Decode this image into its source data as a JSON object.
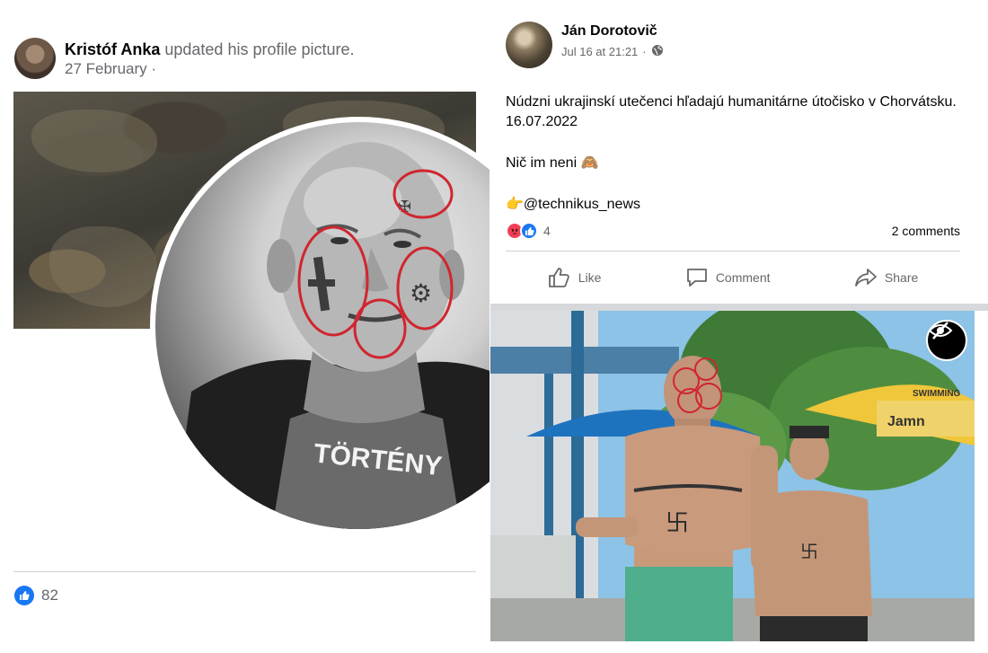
{
  "left_post": {
    "author": "Kristóf Anka",
    "action": "updated his profile picture.",
    "date": "27 February",
    "date_suffix": "·",
    "reaction_count": "82",
    "icons": {
      "reaction": "like-icon",
      "avatar": "avatar-photo"
    },
    "shirt_text": "TÖRTÉNY"
  },
  "right_post": {
    "author": "Ján Dorotovič",
    "timestamp": "Jul 16 at 21:21",
    "separator": "·",
    "privacy_icon": "globe-icon",
    "body": {
      "line1": "Núdzni ukrajinskí utečenci hľadajú humanitárne útočisko v Chorvátsku. 16.07.2022",
      "line2": "Nič im neni 🙈",
      "line3": "👉@technikus_news"
    },
    "reaction_count": "4",
    "comments": "2 comments",
    "actions": {
      "like": "Like",
      "comment": "Comment",
      "share": "Share"
    },
    "photo_signs": {
      "sign1": "Jamn",
      "sign2": "SWIMMING"
    },
    "colors": {
      "accent": "#1877f2",
      "angry": "#f33e58",
      "annotation": "#d0262f"
    }
  }
}
